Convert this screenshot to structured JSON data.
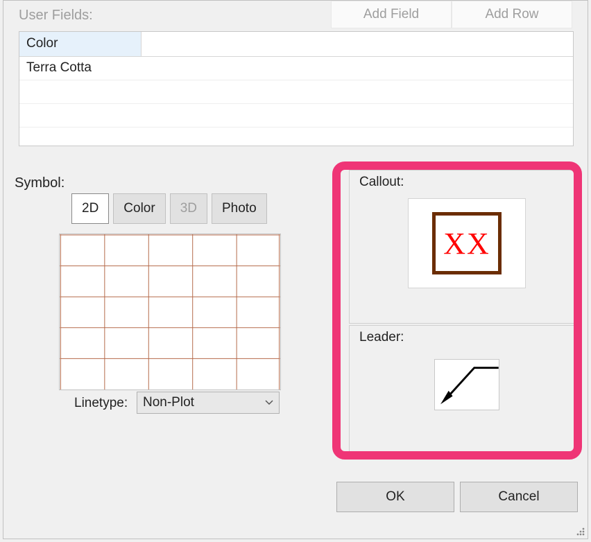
{
  "user_fields": {
    "label": "User Fields:",
    "add_field": "Add Field",
    "add_row": "Add Row",
    "column_header": "Color",
    "rows": [
      "Terra Cotta"
    ]
  },
  "symbol": {
    "label": "Symbol:",
    "tabs": {
      "twod": "2D",
      "color": "Color",
      "threed": "3D",
      "photo": "Photo"
    },
    "linetype_label": "Linetype:",
    "linetype_value": "Non-Plot"
  },
  "callout": {
    "label": "Callout:",
    "text": "XX"
  },
  "leader": {
    "label": "Leader:"
  },
  "buttons": {
    "ok": "OK",
    "cancel": "Cancel"
  }
}
